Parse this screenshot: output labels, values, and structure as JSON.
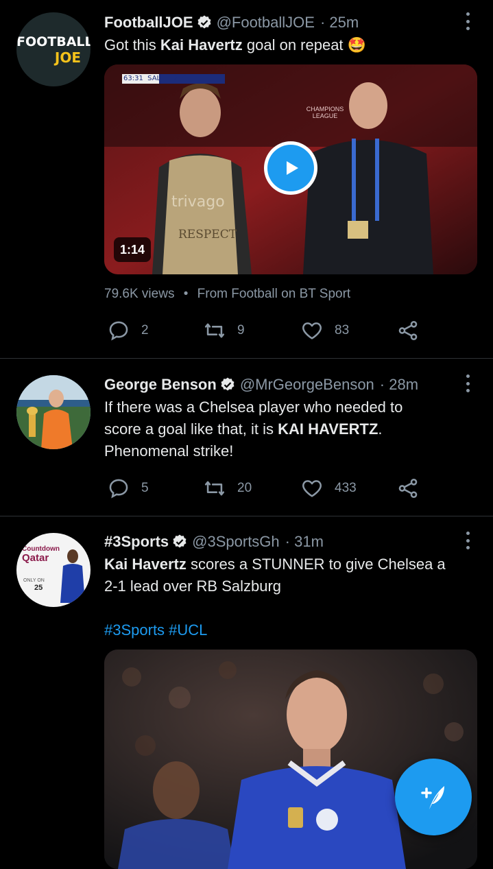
{
  "tweets": [
    {
      "name": "FootballJOE",
      "handle": "@FootballJOE",
      "time": "· 25m",
      "text_plain_1": "Got this ",
      "text_bold": "Kai Havertz",
      "text_plain_2": " goal on repeat 🤩",
      "avatar_line1": "FOOTBALL",
      "avatar_line2": "JOE",
      "video": {
        "duration": "1:14",
        "scoreboard": "63:31  SAL  1  2  CHE",
        "board_text_1": "trivago",
        "board_text_2": "RESPECT",
        "league_text": "CHAMPIONS LEAGUE",
        "views": "79.6K views",
        "separator": "•",
        "source": "From Football on BT Sport"
      },
      "replies": "2",
      "retweets": "9",
      "likes": "83"
    },
    {
      "name": "George Benson",
      "handle": "@MrGeorgeBenson",
      "time": "· 28m",
      "text_line1": "If there was a Chelsea player who needed to",
      "text_line2_plain": "score a goal like that, it is ",
      "text_line2_bold": "KAI HAVERTZ",
      "text_line2_end": ".",
      "text_line3": "Phenomenal strike!",
      "replies": "5",
      "retweets": "20",
      "likes": "433"
    },
    {
      "name": "#3Sports",
      "handle": "@3SportsGh",
      "time": "· 31m",
      "text_bold": "Kai Havertz",
      "text_plain_1": " scores a STUNNER to give Chelsea a",
      "text_line2": "2-1 lead over RB Salzburg",
      "hashtags": "#3Sports #UCL",
      "avatar_text_1": "Countdown",
      "avatar_text_2": "Qatar",
      "avatar_text_3": "ONLY ON",
      "avatar_text_4": "25"
    }
  ],
  "colors": {
    "background": "#000000",
    "accent": "#1d9bf0",
    "muted": "#8b98a5",
    "divider": "#2f3336"
  },
  "icons": [
    "more-icon",
    "verified-icon",
    "play-icon",
    "reply-icon",
    "retweet-icon",
    "like-icon",
    "share-icon",
    "compose-icon"
  ]
}
